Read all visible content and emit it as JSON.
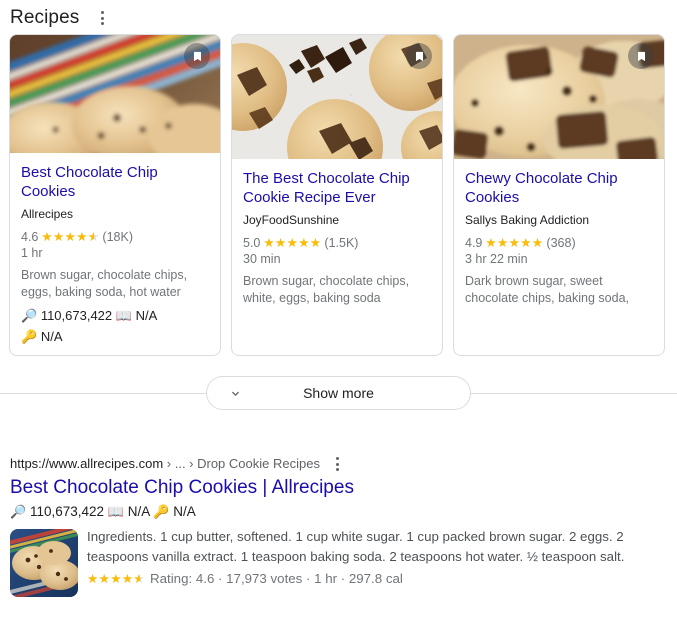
{
  "module": {
    "title": "Recipes",
    "menu_icon": "kebab-menu-icon"
  },
  "colors": {
    "link": "#1a0dab",
    "star": "#fbbc04",
    "text": "#202124",
    "muted": "#70757a",
    "border": "#dadce0"
  },
  "cards": [
    {
      "title": "Best Chocolate Chip Cookies",
      "source": "Allrecipes",
      "rating": "4.6",
      "stars_pct": 90,
      "rating_count": "(18K)",
      "time": "1 hr",
      "ingredients": "Brown sugar, chocolate chips, eggs, baking soda, hot water",
      "metric_search_icon": "🔎",
      "metric_search_value": "110,673,422",
      "metric_book_icon": "📖",
      "metric_book_value": "N/A",
      "metric_key_icon": "🔑",
      "metric_key_value": "N/A",
      "bookmark_icon": "bookmark-icon"
    },
    {
      "title": "The Best Chocolate Chip Cookie Recipe Ever",
      "source": "JoyFoodSunshine",
      "rating": "5.0",
      "stars_pct": 100,
      "rating_count": "(1.5K)",
      "time": "30 min",
      "ingredients": "Brown sugar, chocolate chips, white, eggs, baking soda",
      "metric_search_icon": "",
      "metric_search_value": "",
      "metric_book_icon": "",
      "metric_book_value": "",
      "metric_key_icon": "",
      "metric_key_value": "",
      "bookmark_icon": "bookmark-icon"
    },
    {
      "title": "Chewy Chocolate Chip Cookies",
      "source": "Sallys Baking Addiction",
      "rating": "4.9",
      "stars_pct": 98,
      "rating_count": "(368)",
      "time": "3 hr 22 min",
      "ingredients": "Dark brown sugar, sweet chocolate chips, baking soda,",
      "metric_search_icon": "",
      "metric_search_value": "",
      "metric_book_icon": "",
      "metric_book_value": "",
      "metric_key_icon": "",
      "metric_key_value": "",
      "bookmark_icon": "bookmark-icon"
    }
  ],
  "show_more": {
    "label": "Show more",
    "icon": "chevron-down-icon"
  },
  "result": {
    "url_base": "https://www.allrecipes.com",
    "url_crumbs": " › ... › Drop Cookie Recipes",
    "menu_icon": "kebab-menu-icon",
    "title": "Best Chocolate Chip Cookies | Allrecipes",
    "metric_search_icon": "🔎",
    "metric_search_value": "110,673,422",
    "metric_book_icon": "📖",
    "metric_book_value": "N/A",
    "metric_key_icon": "🔑",
    "metric_key_value": "N/A",
    "snippet": "Ingredients. 1 cup butter, softened. 1 cup white sugar. 1 cup packed brown sugar. 2 eggs. 2 teaspoons vanilla extract. 1 teaspoon baking soda. 2 teaspoons hot water. ½ teaspoon salt.",
    "rating_stars_pct": 92,
    "rating_text": "Rating: 4.6 · 17,973 votes · 1 hr · 297.8 cal"
  }
}
